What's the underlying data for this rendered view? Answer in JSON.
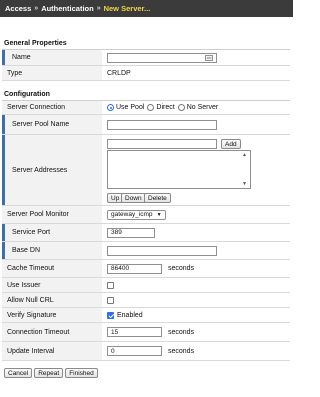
{
  "breadcrumb": {
    "items": [
      "Access",
      "Authentication",
      "New Server..."
    ],
    "separator": "»"
  },
  "general": {
    "title": "General Properties",
    "name_label": "Name",
    "name_value": "",
    "type_label": "Type",
    "type_value": "CRLDP"
  },
  "config": {
    "title": "Configuration",
    "server_connection": {
      "label": "Server Connection",
      "options": [
        "Use Pool",
        "Direct",
        "No Server"
      ],
      "selected": "Use Pool"
    },
    "server_pool_name": {
      "label": "Server Pool Name",
      "value": ""
    },
    "server_addresses": {
      "label": "Server Addresses",
      "input_value": "",
      "add_label": "Add",
      "buttons": [
        "Up",
        "Down",
        "Delete"
      ]
    },
    "server_pool_monitor": {
      "label": "Server Pool Monitor",
      "value": "gateway_icmp"
    },
    "service_port": {
      "label": "Service Port",
      "value": "389"
    },
    "base_dn": {
      "label": "Base DN",
      "value": ""
    },
    "cache_timeout": {
      "label": "Cache Timeout",
      "value": "86400",
      "unit": "seconds"
    },
    "use_issuer": {
      "label": "Use Issuer",
      "checked": false
    },
    "allow_null_crl": {
      "label": "Allow Null CRL",
      "checked": false
    },
    "verify_signature": {
      "label": "Verify Signature",
      "checked": true,
      "text": "Enabled"
    },
    "connection_timeout": {
      "label": "Connection Timeout",
      "value": "15",
      "unit": "seconds"
    },
    "update_interval": {
      "label": "Update Interval",
      "value": "0",
      "unit": "seconds"
    }
  },
  "footer": {
    "cancel": "Cancel",
    "repeat": "Repeat",
    "finished": "Finished"
  },
  "colors": {
    "titlebar": "#3b3b3b",
    "current_crumb": "#f4d24a",
    "required_marker": "#3f6fa8",
    "label_bg": "#f2f2f2",
    "accent": "#2d6fe0"
  }
}
